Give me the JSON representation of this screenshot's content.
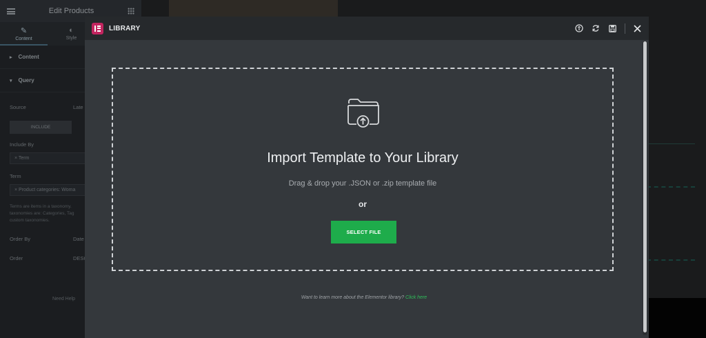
{
  "panel": {
    "title": "Edit Products",
    "tabs": [
      {
        "label": "Content",
        "icon": "pencil-icon"
      },
      {
        "label": "Style",
        "icon": "contrast-icon"
      }
    ],
    "sections": [
      "Content",
      "Query"
    ],
    "source_label": "Source",
    "source_value": "Late",
    "include_tab": "INCLUDE",
    "include_by_label": "Include By",
    "include_by_value": "× Term",
    "term_label": "Term",
    "term_value": "× Product categories: Woma",
    "hint_text": "Terms are items in a taxonomy. taxonomies are: Categories, Tag custom taxonomies.",
    "order_by_label": "Order By",
    "order_by_value": "Date",
    "order_label": "Order",
    "order_value": "DESC",
    "need_help": "Need Help"
  },
  "modal": {
    "title": "LIBRARY",
    "header_icons": [
      "info-icon",
      "sync-icon",
      "save-icon",
      "close-icon"
    ],
    "dropzone": {
      "icon": "folder-upload-icon",
      "title": "Import Template to Your Library",
      "subtitle": "Drag & drop your .JSON or .zip template file",
      "or": "or",
      "button": "SELECT FILE"
    },
    "footer": {
      "text": "Want to learn more about the Elementor library?",
      "link": "Click here"
    }
  },
  "colors": {
    "accent_green": "#1eac4b",
    "logo_pink": "#c2255f",
    "modal_bg": "#34383c"
  }
}
